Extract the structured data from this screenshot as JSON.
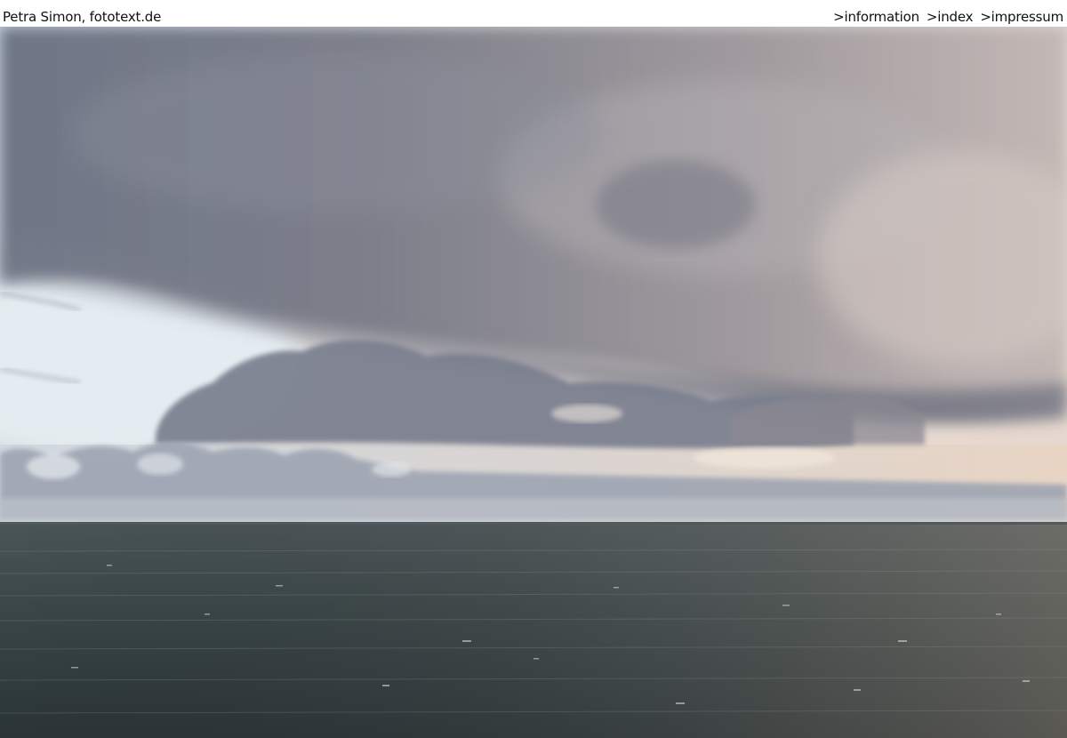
{
  "header": {
    "site_title": "Petra Simon, fototext.de",
    "nav": [
      {
        "label": ">information"
      },
      {
        "label": ">index"
      },
      {
        "label": ">impressum"
      }
    ]
  },
  "photo": {
    "subject": "seascape-clouds-horizon"
  }
}
